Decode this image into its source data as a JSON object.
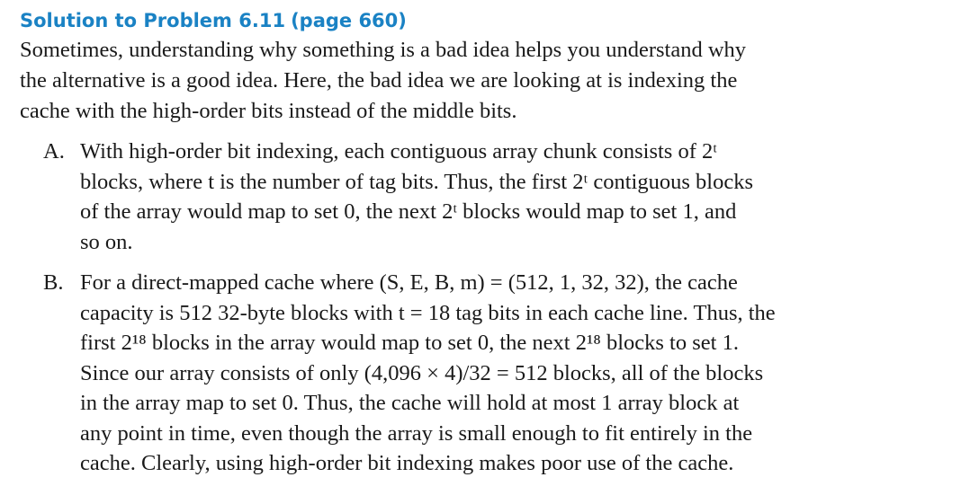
{
  "heading": {
    "title": "Solution to Problem 6.11",
    "page_ref": "(page 660)"
  },
  "intro": {
    "lines": [
      "Sometimes, understanding why something is a bad idea helps you understand why",
      "the alternative is a good idea. Here, the bad idea we are looking at is indexing the",
      "cache with the high-order bits instead of the middle bits."
    ]
  },
  "items": [
    {
      "letter": "A.",
      "lines": [
        "With high-order bit indexing, each contiguous array chunk consists of 2ᵗ",
        "blocks, where t is the number of tag bits. Thus, the first 2ᵗ contiguous blocks",
        "of the array would map to set 0, the next 2ᵗ blocks would map to set 1, and",
        "so on."
      ]
    },
    {
      "letter": "B.",
      "lines": [
        "For a direct-mapped cache where (S, E, B, m) = (512, 1, 32, 32), the cache",
        "capacity is 512 32-byte blocks with t = 18 tag bits in each cache line. Thus, the",
        "first 2¹⁸ blocks in the array would map to set 0, the next 2¹⁸ blocks to set 1.",
        "Since our array consists of only (4,096 × 4)/32 = 512 blocks, all of the blocks",
        "in the array map to set 0. Thus, the cache will hold at most 1 array block at",
        "any point in time, even though the array is small enough to fit entirely in the",
        "cache. Clearly, using high-order bit indexing makes poor use of the cache."
      ]
    }
  ]
}
